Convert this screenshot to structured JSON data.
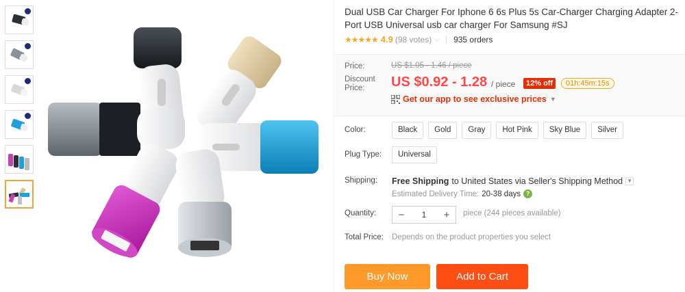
{
  "thumbnails": [
    {
      "name": "thumbnail-black",
      "color": "#2b2f36"
    },
    {
      "name": "thumbnail-gray",
      "color": "#8b9198"
    },
    {
      "name": "thumbnail-white",
      "color": "#e6e6e6"
    },
    {
      "name": "thumbnail-blue",
      "color": "#1ea0db"
    },
    {
      "name": "thumbnail-group",
      "color": "#c43fb4"
    },
    {
      "name": "thumbnail-set",
      "color": "#f2a33c"
    }
  ],
  "product": {
    "title": "Dual USB Car Charger For Iphone 6 6s Plus 5s Car-Charger Charging Adapter 2-Port USB Universal usb car charger For Samsung #SJ",
    "stars": "★★★★★",
    "rating": "4.9",
    "votes": "(98 votes)",
    "orders": "935 orders"
  },
  "price": {
    "label": "Price:",
    "original": "US $1.05 - 1.46 / piece",
    "discount_label_1": "Discount",
    "discount_label_2": "Price:",
    "discount": "US $0.92 - 1.28",
    "unit": "/ piece",
    "off_badge": "12% off",
    "timer": "01h:45m:15s",
    "app_promo": "Get our app to see exclusive prices"
  },
  "color": {
    "label": "Color:",
    "options": [
      "Black",
      "Gold",
      "Gray",
      "Hot Pink",
      "Sky Blue",
      "Silver"
    ]
  },
  "plug": {
    "label": "Plug Type:",
    "options": [
      "Universal"
    ]
  },
  "shipping": {
    "label": "Shipping:",
    "free": "Free Shipping",
    "to": "to United States via Seller's Shipping Method",
    "estimate_label": "Estimated Delivery Time:",
    "estimate_days": "20-38 days"
  },
  "quantity": {
    "label": "Quantity:",
    "value": "1",
    "minus": "−",
    "plus": "+",
    "note": "piece (244 pieces available)"
  },
  "total": {
    "label": "Total Price:",
    "note": "Depends on the product properties you select"
  },
  "actions": {
    "buy_now": "Buy Now",
    "add_to_cart": "Add to Cart"
  },
  "colors": {
    "accent_orange": "#fe9a2b",
    "accent_red": "#ff4e13",
    "price_red": "#ff4747",
    "star": "#f5a623"
  }
}
